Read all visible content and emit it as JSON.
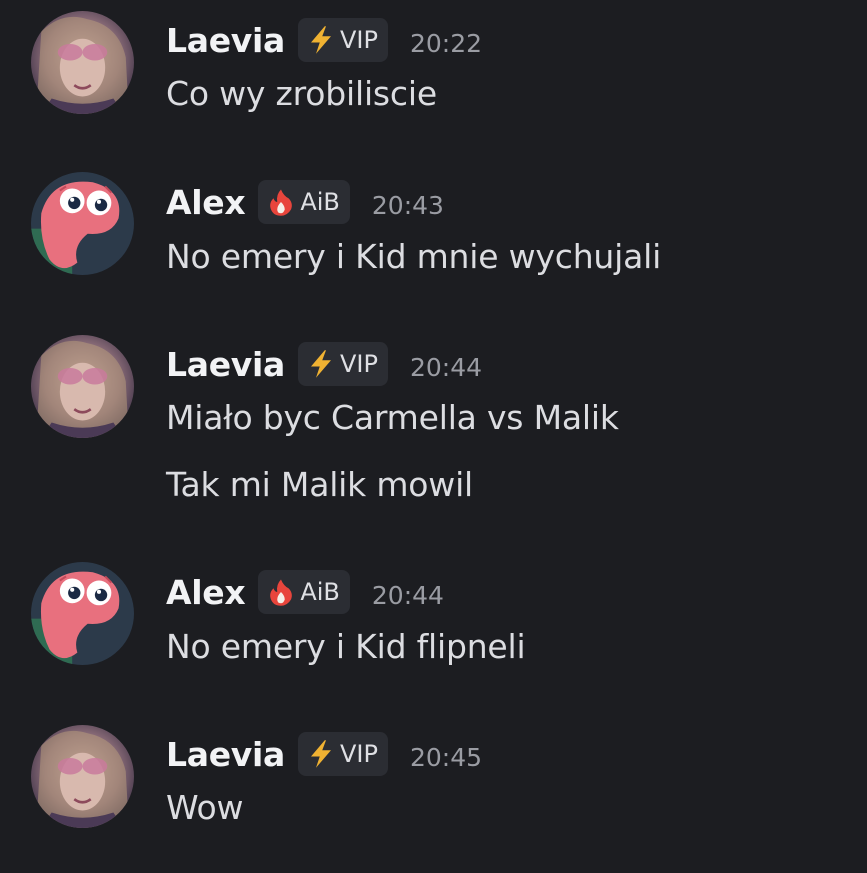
{
  "messages": [
    {
      "username": "Laevia",
      "badge": {
        "icon": "lightning-icon",
        "label": "VIP"
      },
      "time": "20:22",
      "lines": [
        "Co wy zrobiliscie"
      ]
    },
    {
      "username": "Alex",
      "badge": {
        "icon": "flame-icon",
        "label": "AiB"
      },
      "time": "20:43",
      "lines": [
        "No emery i Kid mnie wychujali"
      ]
    },
    {
      "username": "Laevia",
      "badge": {
        "icon": "lightning-icon",
        "label": "VIP"
      },
      "time": "20:44",
      "lines": [
        "Miało byc Carmella vs Malik",
        "Tak mi Malik mowil"
      ]
    },
    {
      "username": "Alex",
      "badge": {
        "icon": "flame-icon",
        "label": "AiB"
      },
      "time": "20:44",
      "lines": [
        "No emery i Kid flipneli"
      ]
    },
    {
      "username": "Laevia",
      "badge": {
        "icon": "lightning-icon",
        "label": "VIP"
      },
      "time": "20:45",
      "lines": [
        "Wow"
      ]
    }
  ],
  "colors": {
    "background": "#1c1d21",
    "username": "#f2f3f5",
    "message_text": "#dcdde1",
    "timestamp": "#9a9ca3",
    "badge_bg": "#2b2d33",
    "vip_bolt": "#f0b232",
    "aib_flame": "#e8453c"
  }
}
